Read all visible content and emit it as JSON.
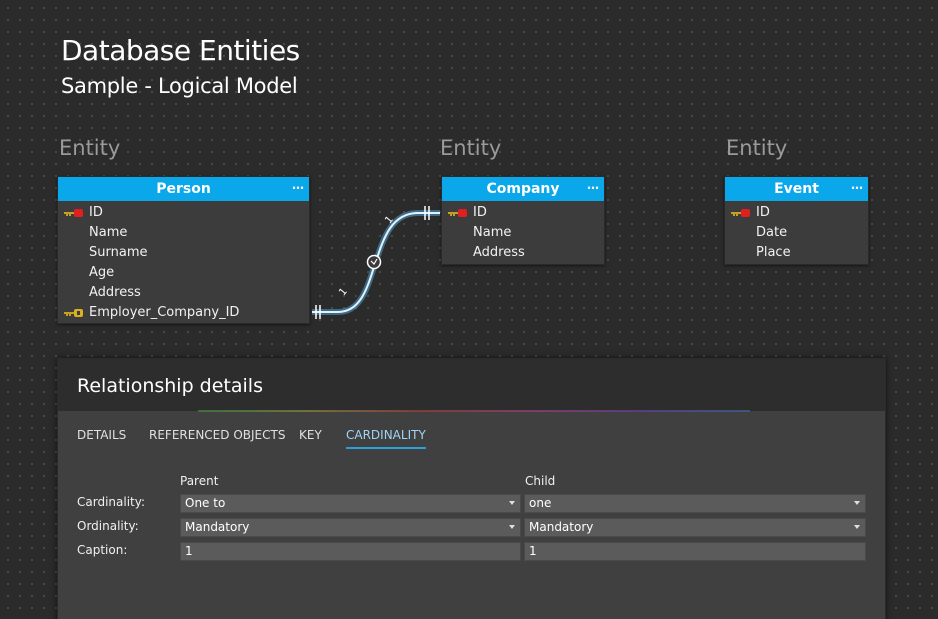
{
  "diagram": {
    "title": "Database Entities",
    "subtitle": "Sample - Logical Model"
  },
  "colors": {
    "entity_header": "#0aa8ea",
    "relationship_line": "#5ab8f0",
    "active_tab_underline": "#2a9fd8",
    "primary_key_icon": "#e02020",
    "foreign_key_icon": "#d8b020"
  },
  "entities": [
    {
      "label": "Entity",
      "name": "Person",
      "menu": "…",
      "attributes": [
        {
          "name": "ID",
          "key": "primary-key-icon"
        },
        {
          "name": "Name",
          "key": ""
        },
        {
          "name": "Surname",
          "key": ""
        },
        {
          "name": "Age",
          "key": ""
        },
        {
          "name": "Address",
          "key": ""
        },
        {
          "name": "Employer_Company_ID",
          "key": "foreign-key-icon"
        }
      ]
    },
    {
      "label": "Entity",
      "name": "Company",
      "menu": "…",
      "attributes": [
        {
          "name": "ID",
          "key": "primary-key-icon"
        },
        {
          "name": "Name",
          "key": ""
        },
        {
          "name": "Address",
          "key": ""
        }
      ]
    },
    {
      "label": "Entity",
      "name": "Event",
      "menu": "…",
      "attributes": [
        {
          "name": "ID",
          "key": "primary-key-icon"
        },
        {
          "name": "Date",
          "key": ""
        },
        {
          "name": "Place",
          "key": ""
        }
      ]
    }
  ],
  "relationship": {
    "parent_caption": "1",
    "child_caption": "1"
  },
  "panel": {
    "title": "Relationship details",
    "tabs": [
      {
        "label": "DETAILS",
        "active": false
      },
      {
        "label": "REFERENCED OBJECTS",
        "active": false
      },
      {
        "label": "KEY",
        "active": false
      },
      {
        "label": "CARDINALITY",
        "active": true
      }
    ],
    "columns": {
      "parent": "Parent",
      "child": "Child"
    },
    "rows": {
      "cardinality": {
        "label": "Cardinality:",
        "parent": "One to",
        "child": "one"
      },
      "ordinality": {
        "label": "Ordinality:",
        "parent": "Mandatory",
        "child": "Mandatory"
      },
      "caption": {
        "label": "Caption:",
        "parent": "1",
        "child": "1"
      }
    }
  }
}
